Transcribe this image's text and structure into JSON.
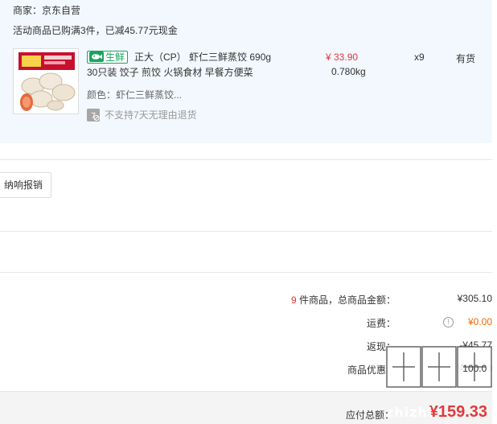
{
  "order": {
    "seller": "商家：京东自营",
    "promo": "活动商品已购满3件，已减45.77元现金"
  },
  "product": {
    "tag_label": "生鲜",
    "tag_icon": "fish-icon",
    "name": "正大（CP） 虾仁三鲜蒸饺 690g",
    "subtitle": "30只装 饺子 煎饺 火锅食材 早餐方便菜",
    "color": "颜色：虾仁三鲜蒸饺...",
    "return_policy": "不支持7天无理由退货",
    "price": "¥ 33.90",
    "weight": "0.780kg",
    "quantity": "x9",
    "stock": "有货"
  },
  "invoice": {
    "button_label": "纳响报销"
  },
  "summary": {
    "item_count": "9",
    "total_label": " 件商品，总商品金额：",
    "total_value": "¥305.10",
    "freight_label": "运费：",
    "freight_value": "¥0.00",
    "cashback_label": "返现：",
    "cashback_value": "-¥45.77",
    "discount_label": "商品优惠：",
    "discount_value": "¥100.00"
  },
  "footer": {
    "payable_label": "应付总额：",
    "payable_value": "¥159.33"
  },
  "watermark": {
    "text": "zhizhi"
  },
  "colors": {
    "accent_red": "#e4393c",
    "fresh_green": "#1aa260",
    "freight_orange": "#f56600",
    "panel_blue": "#f3f8fe"
  }
}
